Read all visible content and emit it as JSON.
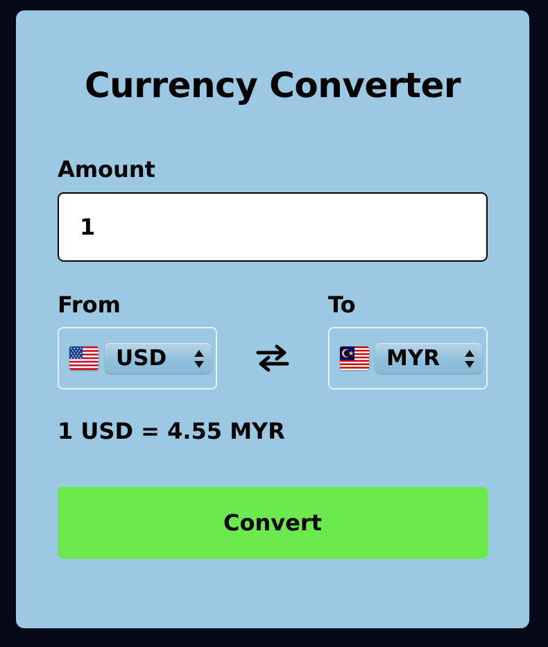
{
  "title": "Currency Converter",
  "amount": {
    "label": "Amount",
    "value": "1"
  },
  "from": {
    "label": "From",
    "currency": "USD",
    "flag": "us-flag-icon"
  },
  "to": {
    "label": "To",
    "currency": "MYR",
    "flag": "my-flag-icon"
  },
  "swap_icon": "swap-arrows-icon",
  "rate_text": "1 USD = 4.55 MYR",
  "convert_label": "Convert",
  "colors": {
    "background": "#030916",
    "card": "#9bc8e2",
    "button": "#6bea4e",
    "input_border": "#000000",
    "select_border": "#e6f2f9"
  }
}
